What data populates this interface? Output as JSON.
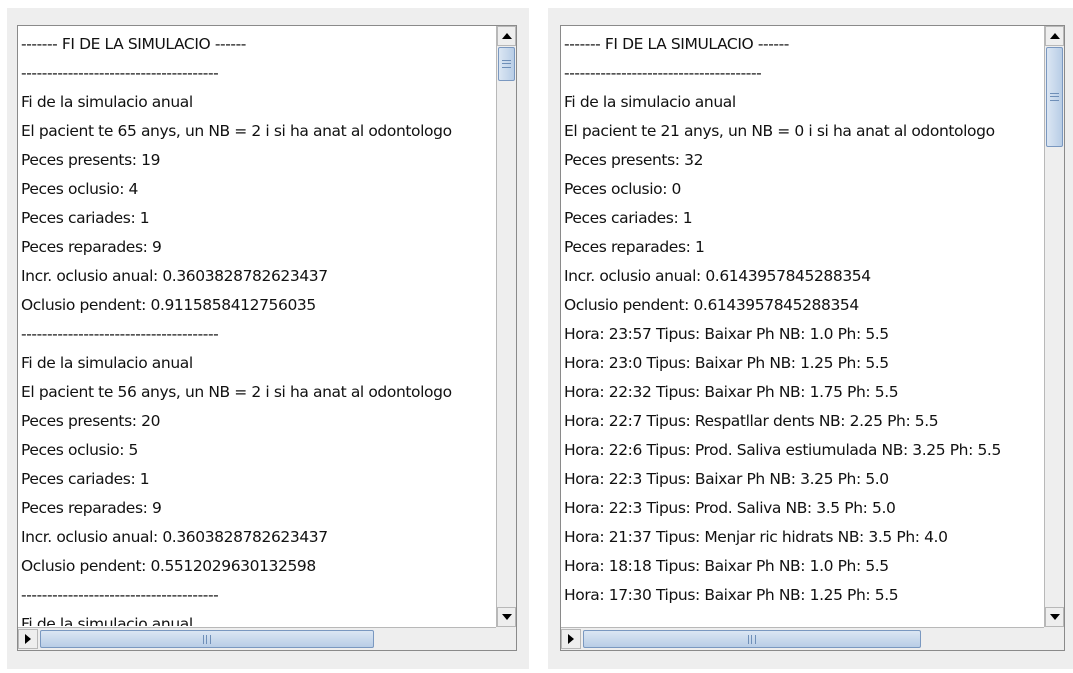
{
  "left_pane": {
    "lines": [
      "------- FI  DE LA SIMULACIO  ------",
      "--------------------------------------",
      " Fi de la simulacio anual",
      "El pacient te 65 anys, un NB = 2 i si ha anat al odontologo",
      "Peces presents: 19",
      "Peces oclusio: 4",
      "Peces cariades: 1",
      "Peces reparades: 9",
      "Incr. oclusio anual: 0.3603828782623437",
      "Oclusio pendent: 0.9115858412756035",
      "--------------------------------------",
      " Fi de la simulacio anual",
      "El pacient te 56 anys, un NB = 2 i si ha anat al odontologo",
      "Peces presents: 20",
      "Peces oclusio: 5",
      "Peces cariades: 1",
      "Peces reparades: 9",
      "Incr. oclusio anual: 0.3603828782623437",
      "Oclusio pendent: 0.5512029630132598",
      "--------------------------------------",
      " Fi de la simulacio anual"
    ]
  },
  "right_pane": {
    "lines": [
      "------- FI  DE LA SIMULACIO  ------",
      "--------------------------------------",
      " Fi de la simulacio anual",
      "El pacient te 21 anys, un NB = 0 i si ha anat al odontologo",
      "Peces presents: 32",
      "Peces oclusio: 0",
      "Peces cariades: 1",
      "Peces reparades: 1",
      "Incr. oclusio anual: 0.6143957845288354",
      "Oclusio pendent: 0.6143957845288354",
      "Hora: 23:57 Tipus: Baixar Ph NB: 1.0 Ph: 5.5",
      "Hora: 23:0 Tipus: Baixar Ph NB: 1.25 Ph: 5.5",
      "Hora: 22:32 Tipus: Baixar Ph NB: 1.75 Ph: 5.5",
      "Hora: 22:7 Tipus: Respatllar dents NB: 2.25 Ph: 5.5",
      "Hora: 22:6 Tipus: Prod. Saliva estiumulada NB: 3.25 Ph: 5.5",
      "Hora: 22:3 Tipus: Baixar Ph NB: 3.25 Ph: 5.0",
      "Hora: 22:3 Tipus: Prod. Saliva NB: 3.5 Ph: 5.0",
      "Hora: 21:37 Tipus: Menjar ric hidrats NB: 3.5 Ph: 4.0",
      "Hora: 18:18 Tipus: Baixar Ph NB: 1.0 Ph: 5.5",
      "Hora: 17:30 Tipus: Baixar Ph NB: 1.25 Ph: 5.5"
    ]
  },
  "icons": {
    "scroll_up": "arrow-up-icon",
    "scroll_down": "arrow-down-icon",
    "scroll_left": "arrow-left-icon",
    "scroll_right": "arrow-right-icon",
    "thumb_grip": "grip-icon"
  },
  "colors": {
    "panel_bg": "#eeeeee",
    "text_bg": "#ffffff",
    "thumb": "#b8cde6"
  }
}
